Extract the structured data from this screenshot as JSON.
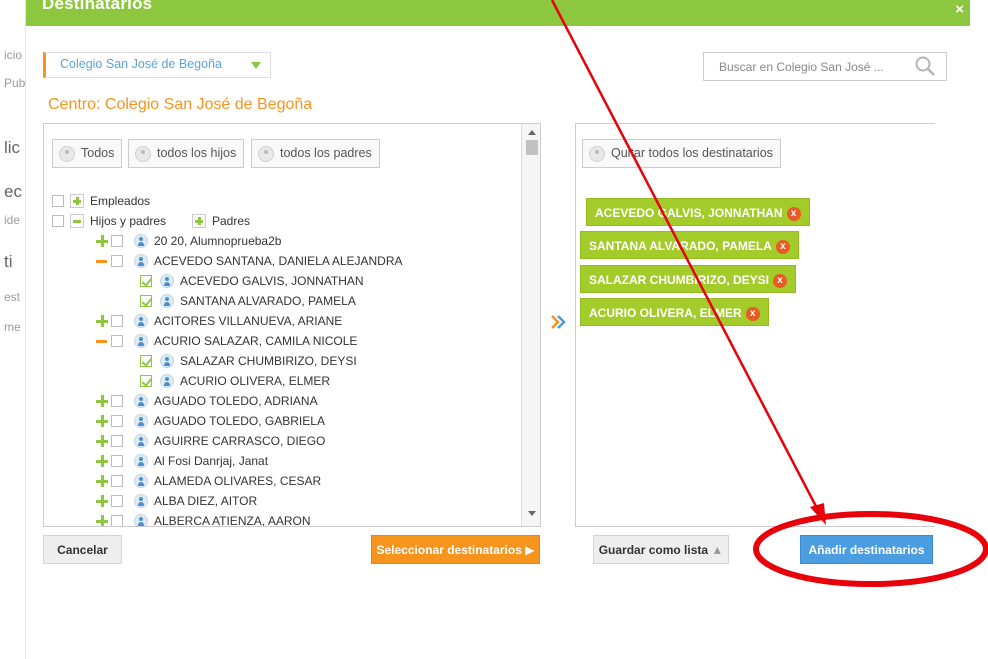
{
  "background": {
    "items": [
      "icio",
      "Pub",
      "lic",
      "ec",
      "ide",
      "ti",
      "est",
      "me"
    ]
  },
  "modal": {
    "title": "Destinatarios",
    "close": "×",
    "school_select": "Colegio San José de Begoña",
    "search_placeholder": "Buscar en Colegio San José ...",
    "centro_title": "Centro: Colegio San José de Begoña"
  },
  "filters": {
    "all": "Todos",
    "children": "todos los hijos",
    "parents": "todos los padres"
  },
  "tree": [
    {
      "label": "Empleados"
    },
    {
      "label": "Hijos y padres"
    },
    {
      "label": "Padres"
    },
    {
      "label": "20 20, Alumnoprueba2b"
    },
    {
      "label": "ACEVEDO SANTANA, DANIELA ALEJANDRA"
    },
    {
      "label": "ACEVEDO GALVIS, JONNATHAN"
    },
    {
      "label": "SANTANA ALVARADO, PAMELA"
    },
    {
      "label": "ACITORES VILLANUEVA, ARIANE"
    },
    {
      "label": "ACURIO SALAZAR, CAMILA NICOLE"
    },
    {
      "label": "SALAZAR CHUMBIRIZO, DEYSI"
    },
    {
      "label": "ACURIO OLIVERA, ELMER"
    },
    {
      "label": "AGUADO TOLEDO, ADRIANA"
    },
    {
      "label": "AGUADO TOLEDO, GABRIELA"
    },
    {
      "label": "AGUIRRE CARRASCO, DIEGO"
    },
    {
      "label": "Al Fosi Danrjaj, Janat"
    },
    {
      "label": "ALAMEDA OLIVARES, CESAR"
    },
    {
      "label": "ALBA DIEZ, AITOR"
    },
    {
      "label": "ALBERCA ATIENZA, AARON"
    }
  ],
  "right": {
    "remove_all": "Quitar todos los destinatarios",
    "recipients": [
      "ACEVEDO GALVIS, JONNATHAN",
      "SANTANA ALVARADO, PAMELA",
      "SALAZAR CHUMBIRIZO, DEYSI",
      "ACURIO OLIVERA, ELMER"
    ],
    "remove_glyph": "x"
  },
  "buttons": {
    "cancel": "Cancelar",
    "select": "Seleccionar destinatarios",
    "save": "Guardar como lista",
    "add": "Añadir destinatarios"
  },
  "colors": {
    "header_green": "#8dc63f",
    "orange": "#f7941d",
    "chip_green": "#a3cc2a",
    "blue": "#4a9de0",
    "annotation_red": "#e8000b"
  }
}
